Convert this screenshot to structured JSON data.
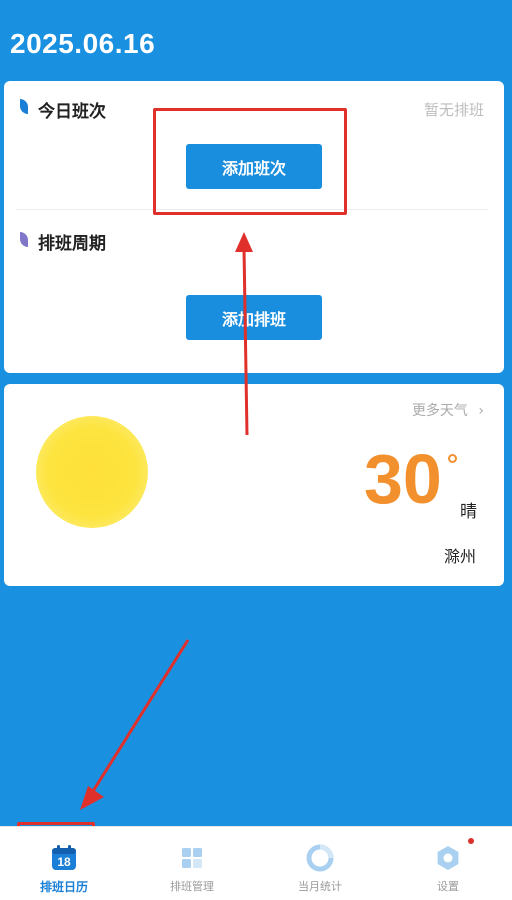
{
  "header": {
    "date": "2025.06.16"
  },
  "today_shift": {
    "title": "今日班次",
    "status": "暂无排班",
    "add_button": "添加班次"
  },
  "shift_cycle": {
    "title": "排班周期",
    "add_button": "添加排班"
  },
  "weather": {
    "more_link": "更多天气",
    "temperature": "30",
    "condition": "晴",
    "city": "滁州",
    "icon": "sun-icon"
  },
  "bottom_nav": {
    "items": [
      {
        "label": "排班日历",
        "icon": "calendar-icon",
        "badge": "18",
        "active": true
      },
      {
        "label": "排班管理",
        "icon": "grid-icon",
        "active": false
      },
      {
        "label": "当月统计",
        "icon": "pie-chart-icon",
        "active": false
      },
      {
        "label": "设置",
        "icon": "gear-icon",
        "active": false
      }
    ]
  },
  "colors": {
    "background": "#1a90e0",
    "accent": "#1a8ede",
    "temperature": "#f3902e",
    "annotation": "#e0302b"
  }
}
